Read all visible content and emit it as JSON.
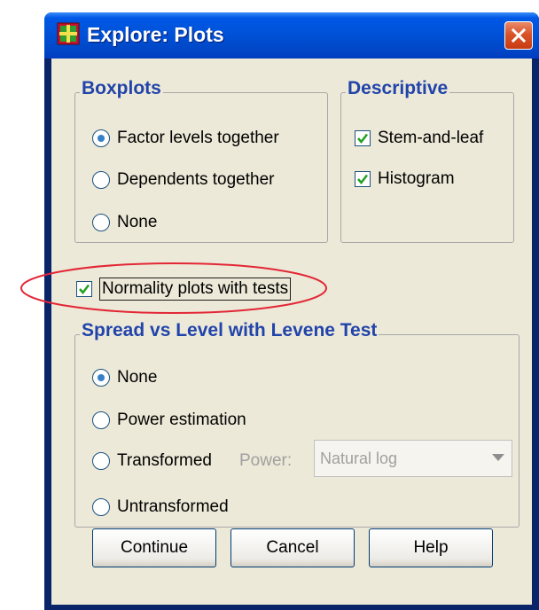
{
  "dialog": {
    "title": "Explore: Plots"
  },
  "boxplots": {
    "legend": "Boxplots",
    "options": [
      "Factor levels together",
      "Dependents together",
      "None"
    ],
    "selected": "Factor levels together"
  },
  "descriptive": {
    "legend": "Descriptive",
    "stem_and_leaf": "Stem-and-leaf",
    "histogram": "Histogram",
    "stem_and_leaf_checked": true,
    "histogram_checked": true
  },
  "normality": {
    "label": "Normality plots with tests",
    "checked": true
  },
  "spread": {
    "legend": "Spread vs Level with Levene Test",
    "options": [
      "None",
      "Power estimation",
      "Transformed",
      "Untransformed"
    ],
    "selected": "None",
    "power_label": "Power:",
    "power_value": "Natural log"
  },
  "buttons": {
    "continue": "Continue",
    "cancel": "Cancel",
    "help": "Help"
  },
  "colors": {
    "title_bar": "#0054e3",
    "group_legend": "#2244aa",
    "annotation_ellipse": "#e32636",
    "dialog_bg": "#ece9d8"
  },
  "icons": {
    "title": "spss-grid-icon",
    "close": "close-icon",
    "dropdown": "chevron-down-icon"
  }
}
